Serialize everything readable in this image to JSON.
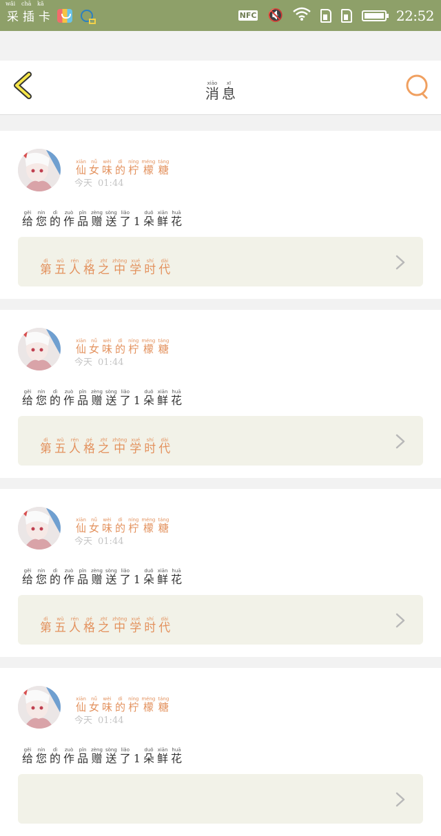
{
  "status_bar": {
    "apps": [
      {
        "char": "采",
        "py": "wăi"
      },
      {
        "char": "插",
        "py": "chā"
      },
      {
        "char": "卡",
        "py": "kă"
      }
    ],
    "nfc_label": "NFC",
    "time": "22:52",
    "colors": {
      "background": "#8ea069"
    }
  },
  "header": {
    "title_chars": [
      {
        "hz": "消",
        "py": "xiāo"
      },
      {
        "hz": "息",
        "py": "xī"
      }
    ],
    "back_icon": "back-chevron-icon",
    "search_icon": "search-icon",
    "accent": "#f6e64a"
  },
  "messages": [
    {
      "sender_chars": [
        {
          "hz": "仙",
          "py": "xiān"
        },
        {
          "hz": "女",
          "py": "nǚ"
        },
        {
          "hz": "味",
          "py": "wèi"
        },
        {
          "hz": "的",
          "py": "dì"
        },
        {
          "hz": "柠",
          "py": "níng"
        },
        {
          "hz": "檬",
          "py": "méng"
        },
        {
          "hz": "糖",
          "py": "táng"
        }
      ],
      "date": "今天",
      "time": "01:44",
      "message_chars": [
        {
          "hz": "给",
          "py": "gěi"
        },
        {
          "hz": "您",
          "py": "nín"
        },
        {
          "hz": "的",
          "py": "dì"
        },
        {
          "hz": "作",
          "py": "zuò"
        },
        {
          "hz": "品",
          "py": "pǐn"
        },
        {
          "hz": "赠",
          "py": "zèng"
        },
        {
          "hz": "送",
          "py": "sòng"
        },
        {
          "hz": "了",
          "py": "liǎo"
        },
        {
          "hz": "1",
          "py": ""
        },
        {
          "hz": "朵",
          "py": "duǒ"
        },
        {
          "hz": "鲜",
          "py": "xiān"
        },
        {
          "hz": "花",
          "py": "huā"
        }
      ],
      "work_chars": [
        {
          "hz": "第",
          "py": "dì"
        },
        {
          "hz": "五",
          "py": "wǔ"
        },
        {
          "hz": "人",
          "py": "rén"
        },
        {
          "hz": "格",
          "py": "gé"
        },
        {
          "hz": "之",
          "py": "zhī"
        },
        {
          "hz": "中",
          "py": "zhōng"
        },
        {
          "hz": "学",
          "py": "xué"
        },
        {
          "hz": "时",
          "py": "shí"
        },
        {
          "hz": "代",
          "py": "dài"
        }
      ]
    },
    {
      "sender_chars": [
        {
          "hz": "仙",
          "py": "xiān"
        },
        {
          "hz": "女",
          "py": "nǚ"
        },
        {
          "hz": "味",
          "py": "wèi"
        },
        {
          "hz": "的",
          "py": "dì"
        },
        {
          "hz": "柠",
          "py": "níng"
        },
        {
          "hz": "檬",
          "py": "méng"
        },
        {
          "hz": "糖",
          "py": "táng"
        }
      ],
      "date": "今天",
      "time": "01:44",
      "message_chars": [
        {
          "hz": "给",
          "py": "gěi"
        },
        {
          "hz": "您",
          "py": "nín"
        },
        {
          "hz": "的",
          "py": "dì"
        },
        {
          "hz": "作",
          "py": "zuò"
        },
        {
          "hz": "品",
          "py": "pǐn"
        },
        {
          "hz": "赠",
          "py": "zèng"
        },
        {
          "hz": "送",
          "py": "sòng"
        },
        {
          "hz": "了",
          "py": "liǎo"
        },
        {
          "hz": "1",
          "py": ""
        },
        {
          "hz": "朵",
          "py": "duǒ"
        },
        {
          "hz": "鲜",
          "py": "xiān"
        },
        {
          "hz": "花",
          "py": "huā"
        }
      ],
      "work_chars": [
        {
          "hz": "第",
          "py": "dì"
        },
        {
          "hz": "五",
          "py": "wǔ"
        },
        {
          "hz": "人",
          "py": "rén"
        },
        {
          "hz": "格",
          "py": "gé"
        },
        {
          "hz": "之",
          "py": "zhī"
        },
        {
          "hz": "中",
          "py": "zhōng"
        },
        {
          "hz": "学",
          "py": "xué"
        },
        {
          "hz": "时",
          "py": "shí"
        },
        {
          "hz": "代",
          "py": "dài"
        }
      ]
    },
    {
      "sender_chars": [
        {
          "hz": "仙",
          "py": "xiān"
        },
        {
          "hz": "女",
          "py": "nǚ"
        },
        {
          "hz": "味",
          "py": "wèi"
        },
        {
          "hz": "的",
          "py": "dì"
        },
        {
          "hz": "柠",
          "py": "níng"
        },
        {
          "hz": "檬",
          "py": "méng"
        },
        {
          "hz": "糖",
          "py": "táng"
        }
      ],
      "date": "今天",
      "time": "01:44",
      "message_chars": [
        {
          "hz": "给",
          "py": "gěi"
        },
        {
          "hz": "您",
          "py": "nín"
        },
        {
          "hz": "的",
          "py": "dì"
        },
        {
          "hz": "作",
          "py": "zuò"
        },
        {
          "hz": "品",
          "py": "pǐn"
        },
        {
          "hz": "赠",
          "py": "zèng"
        },
        {
          "hz": "送",
          "py": "sòng"
        },
        {
          "hz": "了",
          "py": "liǎo"
        },
        {
          "hz": "1",
          "py": ""
        },
        {
          "hz": "朵",
          "py": "duǒ"
        },
        {
          "hz": "鲜",
          "py": "xiān"
        },
        {
          "hz": "花",
          "py": "huā"
        }
      ],
      "work_chars": [
        {
          "hz": "第",
          "py": "dì"
        },
        {
          "hz": "五",
          "py": "wǔ"
        },
        {
          "hz": "人",
          "py": "rén"
        },
        {
          "hz": "格",
          "py": "gé"
        },
        {
          "hz": "之",
          "py": "zhī"
        },
        {
          "hz": "中",
          "py": "zhōng"
        },
        {
          "hz": "学",
          "py": "xué"
        },
        {
          "hz": "时",
          "py": "shí"
        },
        {
          "hz": "代",
          "py": "dài"
        }
      ]
    },
    {
      "sender_chars": [
        {
          "hz": "仙",
          "py": "xiān"
        },
        {
          "hz": "女",
          "py": "nǚ"
        },
        {
          "hz": "味",
          "py": "wèi"
        },
        {
          "hz": "的",
          "py": "dì"
        },
        {
          "hz": "柠",
          "py": "níng"
        },
        {
          "hz": "檬",
          "py": "méng"
        },
        {
          "hz": "糖",
          "py": "táng"
        }
      ],
      "date": "今天",
      "time": "01:44",
      "message_chars": [
        {
          "hz": "给",
          "py": "gěi"
        },
        {
          "hz": "您",
          "py": "nín"
        },
        {
          "hz": "的",
          "py": "dì"
        },
        {
          "hz": "作",
          "py": "zuò"
        },
        {
          "hz": "品",
          "py": "pǐn"
        },
        {
          "hz": "赠",
          "py": "zèng"
        },
        {
          "hz": "送",
          "py": "sòng"
        },
        {
          "hz": "了",
          "py": "liǎo"
        },
        {
          "hz": "1",
          "py": ""
        },
        {
          "hz": "朵",
          "py": "duǒ"
        },
        {
          "hz": "鲜",
          "py": "xiān"
        },
        {
          "hz": "花",
          "py": "huā"
        }
      ],
      "work_chars": []
    }
  ],
  "colors": {
    "sender_name": "#e3915d",
    "work_link_bg": "#f2f2e8",
    "search_ring": "#f0a060"
  }
}
